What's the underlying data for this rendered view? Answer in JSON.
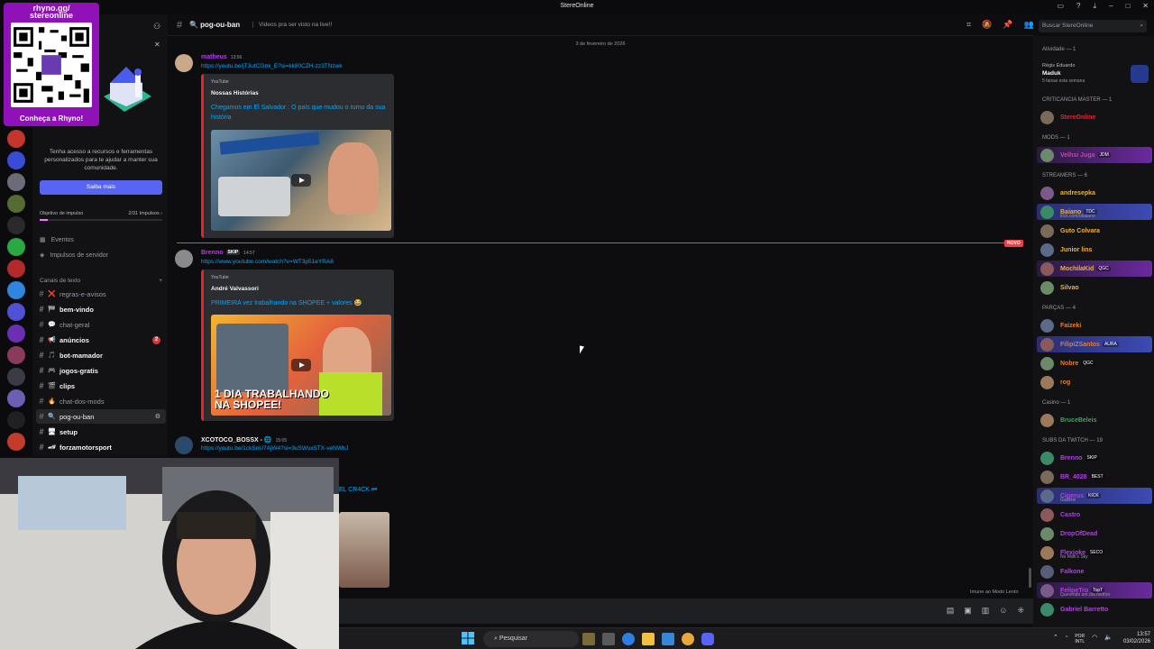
{
  "window": {
    "title": "StereOnline"
  },
  "overlay": {
    "url": "rhyno.gg/\nstereonline",
    "cta": "Conheça a Rhyno!"
  },
  "boost": {
    "description": "Tenha acesso a recursos e ferramentas personalizados para te ajudar a manter sua comunidade.",
    "button": "Saiba mais",
    "goal_label": "Objetivo de impulso",
    "goal_value": "2/31 Impulsos ›",
    "progress": 0.065
  },
  "sidebar": {
    "events": "Eventos",
    "boosts": "Impulsos de servidor",
    "category": "Canais de texto",
    "channels": [
      {
        "emoji": "❌",
        "name": "regras-e-avisos"
      },
      {
        "emoji": "🏁",
        "name": "bem-vindo"
      },
      {
        "emoji": "💬",
        "name": "chat-geral"
      },
      {
        "emoji": "📢",
        "name": "anúncios",
        "badge": "2"
      },
      {
        "emoji": "🎵",
        "name": "bot-mamador"
      },
      {
        "emoji": "🎮",
        "name": "jogos-gratis"
      },
      {
        "emoji": "🎬",
        "name": "clips"
      },
      {
        "emoji": "🔥",
        "name": "chat-dos-mods"
      },
      {
        "emoji": "🔍",
        "name": "pog-ou-ban"
      },
      {
        "emoji": "🖥",
        "name": "setup"
      },
      {
        "emoji": "🏎",
        "name": "forzamotorsport"
      }
    ]
  },
  "header": {
    "channel": "pog-ou-ban",
    "topic": "Videos pra ser visto na live!!",
    "search_placeholder": "Buscar StereOnline"
  },
  "chat": {
    "date": "3 de fevereiro de 2026",
    "new_label": "NOVO",
    "messages": [
      {
        "user": "matheus",
        "time": "13:56",
        "link": "https://youtu.be/jT3utCGmi_E?si=kk80CZH-zz3TNzwk",
        "provider": "YouTube",
        "author": "Nossas Histórias",
        "title": "Chegamos em El Salvador : O país que mudou o rumo da sua história"
      },
      {
        "user": "Brenno",
        "tag": "SKIP",
        "time": "14:57",
        "link": "https://www.youtube.com/watch?v=WT3p51eYRA8",
        "provider": "YouTube",
        "author": "André Valvassori",
        "title": "PRIMEIRA vez trabalhando na SHOPEE + valores 😂"
      },
      {
        "user": "XCOTOCO_BOSSX - 🌐",
        "time": "15:05",
        "link": "https://youtu.be/1ckSnU7AjW4?si=3uSWvxSTX-veNWkJ",
        "title_partial": "EL CR4CK ⏮"
      }
    ],
    "slowmode": "Imune ao Modo Lento"
  },
  "members": {
    "activity": {
      "header": "Atividade — 1",
      "line1": "Régis Eduardo",
      "line2": "Maduk",
      "line3": "5 faixas esta semana"
    },
    "sections": [
      {
        "title": "CRITICANCIA MASTER — 1",
        "list": [
          {
            "name": "StereOnline",
            "color": "#e8232d"
          }
        ]
      },
      {
        "title": "MODS — 1",
        "list": [
          {
            "name": "Velhsi Juga",
            "tag": "JDM",
            "color": "#e03aa0",
            "hl": "p"
          }
        ]
      },
      {
        "title": "STREAMERS — 6",
        "list": [
          {
            "name": "andresepka",
            "color": "#f0b132"
          },
          {
            "name": "Baiano",
            "tag": "TDC",
            "sub": "kick.com/obaiano",
            "color": "#f0b132",
            "hl": "b"
          },
          {
            "name": "Guto Colvara",
            "color": "#f0b132"
          },
          {
            "name": "Junior lins",
            "color": "#f0b132"
          },
          {
            "name": "MochilaKid",
            "tag": "QGC",
            "color": "#f0b132",
            "hl": "p"
          },
          {
            "name": "Silvao",
            "color": "#f0b132"
          }
        ]
      },
      {
        "title": "PARÇAS — 4",
        "list": [
          {
            "name": "Faizeki",
            "color": "#e67e22"
          },
          {
            "name": "FilipiZSantos",
            "tag": "AURA",
            "color": "#e67e22",
            "hl": "b"
          },
          {
            "name": "Nobre",
            "tag": "QGC",
            "color": "#e67e22"
          },
          {
            "name": "rog",
            "color": "#e67e22"
          }
        ]
      },
      {
        "title": "Casino — 1",
        "list": [
          {
            "name": "BruceBeleis",
            "color": "#3ba55c"
          }
        ]
      },
      {
        "title": "SUBS DA TWITCH — 19",
        "list": [
          {
            "name": "Brenno",
            "tag": "SKIP",
            "color": "#b43fe8"
          },
          {
            "name": "BR_4028",
            "tag": "BEST",
            "color": "#b43fe8"
          },
          {
            "name": "Cigerus",
            "tag": "KICK",
            "sub": "Gabiriel",
            "color": "#b43fe8",
            "hl": "b"
          },
          {
            "name": "Castro",
            "color": "#b43fe8"
          },
          {
            "name": "DropOfDead",
            "color": "#b43fe8"
          },
          {
            "name": "Flexjoke",
            "tag": "SECO",
            "sub": "No Man's Sky",
            "color": "#b43fe8"
          },
          {
            "name": "Falkone",
            "color": "#b43fe8"
          },
          {
            "name": "FelipeTro",
            "tag": "TopT",
            "sub": "Querendo um dia melhor",
            "color": "#b43fe8",
            "hl": "p"
          },
          {
            "name": "Gabriel Barretto",
            "color": "#b43fe8"
          }
        ]
      }
    ]
  },
  "taskbar": {
    "search": "Pesquisar",
    "lang": "POR\nINTL",
    "time": "13:57",
    "date": "03/02/2026"
  },
  "colors": {
    "accent": "#5865f2",
    "link": "#00a8fc",
    "youtube": "#e8232d",
    "new": "#f23f43"
  }
}
